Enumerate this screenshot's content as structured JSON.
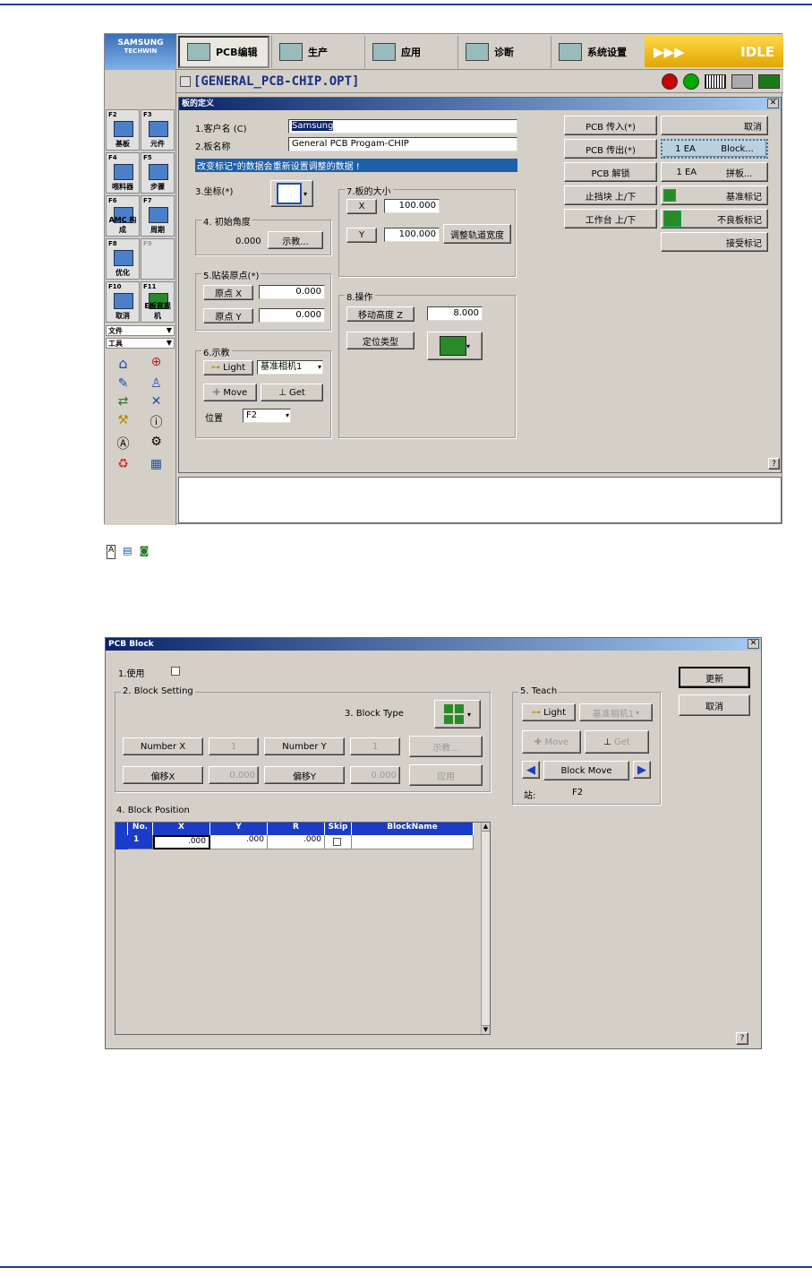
{
  "screen1": {
    "logo": {
      "brand": "SAMSUNG",
      "sub": "TECHWIN"
    },
    "tabs": [
      {
        "label": "PCB编辑",
        "icon": "pcb-edit-icon"
      },
      {
        "label": "生产",
        "icon": "production-icon"
      },
      {
        "label": "应用",
        "icon": "application-icon"
      },
      {
        "label": "诊断",
        "icon": "diagnosis-icon"
      },
      {
        "label": "系统设置",
        "icon": "system-settings-icon"
      }
    ],
    "status": {
      "arrows": "▶▶▶",
      "text": "IDLE"
    },
    "file_title": "[GENERAL_PCB-CHIP.OPT]",
    "fkeys": [
      {
        "key": "F2",
        "label": "基板"
      },
      {
        "key": "F3",
        "label": "元件"
      },
      {
        "key": "F4",
        "label": "喂料器"
      },
      {
        "key": "F5",
        "label": "步骤"
      },
      {
        "key": "F6",
        "label": "AMC 构成"
      },
      {
        "key": "F7",
        "label": "周期"
      },
      {
        "key": "F8",
        "label": "优化"
      },
      {
        "key": "F9",
        "label": ""
      },
      {
        "key": "F10",
        "label": "取消"
      },
      {
        "key": "F11",
        "label": "E板直观机"
      }
    ],
    "menus": {
      "file": "文件",
      "tools": "工具"
    },
    "dialog": {
      "title": "板的定义",
      "customer_label": "1.客户名 (C)",
      "customer_value": "Samsung",
      "board_label": "2.板名称",
      "board_value": "General PCB Progam-CHIP",
      "warning": "改变标记\"的数据会重新设置调整的数据 !",
      "coord_label": "3.坐标(*)",
      "angle_group": "4. 初始角度",
      "angle_value": "0.000",
      "teach_btn": "示教...",
      "origin_group": "5.贴装原点(*)",
      "origin_x_label": "原点 X",
      "origin_x_value": "0.000",
      "origin_y_label": "原点 Y",
      "origin_y_value": "0.000",
      "teach_group": "6.示教",
      "light": "Light",
      "camera": "基准相机1",
      "move": "Move",
      "get": "Get",
      "position_label": "位置",
      "position_value": "F2",
      "size_group": "7.板的大小",
      "size_x_label": "X",
      "size_x_value": "100.000",
      "size_y_label": "Y",
      "size_y_value": "100.000",
      "adjust_rail": "调整轨道宽度",
      "op_group": "8.操作",
      "move_height_label": "移动高度 Z",
      "move_height_value": "8.000",
      "locate_type": "定位类型",
      "right_buttons": {
        "pcb_in": "PCB 传入(*)",
        "cancel": "取消",
        "pcb_out": "PCB 传出(*)",
        "block_ea": "1 EA",
        "block": "Block...",
        "pcb_unlock": "PCB 解锁",
        "panel_ea": "1 EA",
        "panel": "拼板...",
        "stopper": "止挡块 上/下",
        "fiducial": "基准标记",
        "table": "工作台 上/下",
        "bad_mark": "不良板标记",
        "accept_mark": "接受标记"
      },
      "help": "?"
    }
  },
  "screen2": {
    "title": "PCB Block",
    "use_label": "1.使用",
    "setting_group": "2. Block Setting",
    "block_type_label": "3. Block Type",
    "number_x_label": "Number X",
    "number_x_value": "1",
    "number_y_label": "Number Y",
    "number_y_value": "1",
    "teach_btn": "示教...",
    "offset_x_label": "偏移X",
    "offset_x_value": "0.000",
    "offset_y_label": "偏移Y",
    "offset_y_value": "0.000",
    "apply_btn": "应用",
    "update_btn": "更新",
    "cancel_btn": "取消",
    "teach_group": "5. Teach",
    "light": "Light",
    "camera": "基准相机1",
    "move": "Move",
    "get": "Get",
    "block_move": "Block Move",
    "station_label": "站:",
    "station_value": "F2",
    "position_group": "4. Block Position",
    "table": {
      "headers": [
        "No.",
        "X",
        "Y",
        "R",
        "Skip",
        "BlockName"
      ],
      "rows": [
        [
          "1",
          ".000",
          ".000",
          ".000",
          "",
          ""
        ]
      ]
    },
    "help": "?"
  }
}
